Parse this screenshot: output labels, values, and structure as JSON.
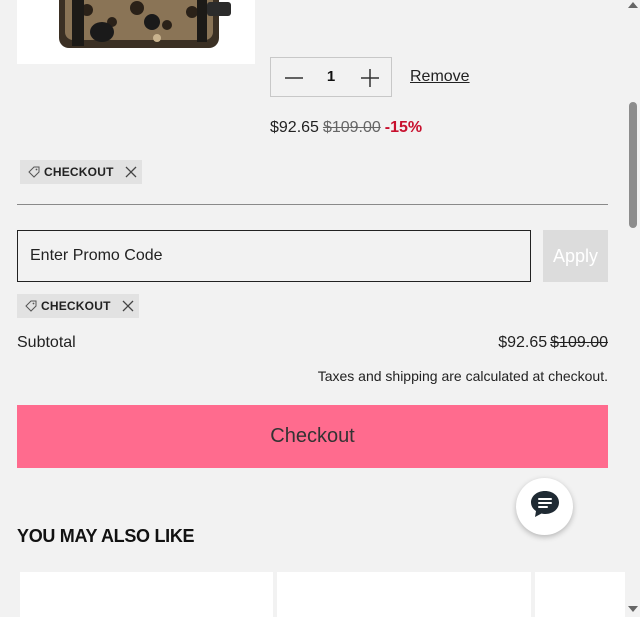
{
  "cart_item": {
    "image_alt": "leopard print crossbody bag",
    "quantity": "1",
    "remove_label": "Remove",
    "price_now": "$92.65",
    "price_was": "$109.00",
    "discount": "-15%"
  },
  "discount_tags": [
    {
      "label": "CHECKOUT"
    },
    {
      "label": "CHECKOUT"
    }
  ],
  "promo": {
    "placeholder": "Enter Promo Code",
    "apply_label": "Apply"
  },
  "summary": {
    "subtotal_label": "Subtotal",
    "subtotal_now": "$92.65",
    "subtotal_was": "$109.00",
    "tax_note": "Taxes and shipping are calculated at checkout."
  },
  "checkout_label": "Checkout",
  "recommendations": {
    "title": "YOU MAY ALSO LIKE"
  },
  "icons": {
    "minus": "minus-icon",
    "plus": "plus-icon",
    "tag": "tag-icon",
    "close": "close-icon",
    "chat": "chat-icon"
  },
  "colors": {
    "checkout_button": "#ff6b8e",
    "discount_text": "#c8102e",
    "background": "#f2f2f2"
  }
}
